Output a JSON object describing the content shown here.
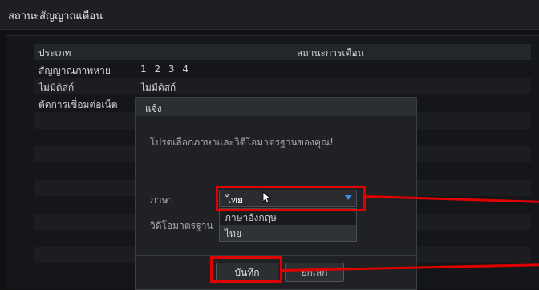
{
  "window": {
    "title": "สถานะสัญญาณเตือน"
  },
  "table": {
    "headers": {
      "type": "ประเภท",
      "status": "สถานะการเตือน"
    },
    "rows": [
      {
        "type": "สัญญาณภาพหาย",
        "value": "1 2 3 4"
      },
      {
        "type": "ไม่มีดิสก์",
        "value": "ไม่มีดิสก์"
      },
      {
        "type": "ตัดการเชื่อมต่อเน็ต",
        "value": ""
      }
    ]
  },
  "dialog": {
    "title": "แจ้ง",
    "message": "โปรดเลือกภาษาและวิดีโอมาตรฐานของคุณ!",
    "language_label": "ภาษา",
    "language_value": "ไทย",
    "video_standard_label": "วิดีโอมาตรฐาน",
    "language_options": [
      "ภาษาอังกฤษ",
      "ไทย"
    ],
    "save_label": "บันทึก",
    "cancel_label": "ยกเลิก"
  },
  "colors": {
    "highlight": "#e00000",
    "dropdown_arrow": "#3a8ee6"
  },
  "icons": {
    "dropdown": "chevron-down-icon",
    "cursor": "mouse-pointer-icon"
  }
}
